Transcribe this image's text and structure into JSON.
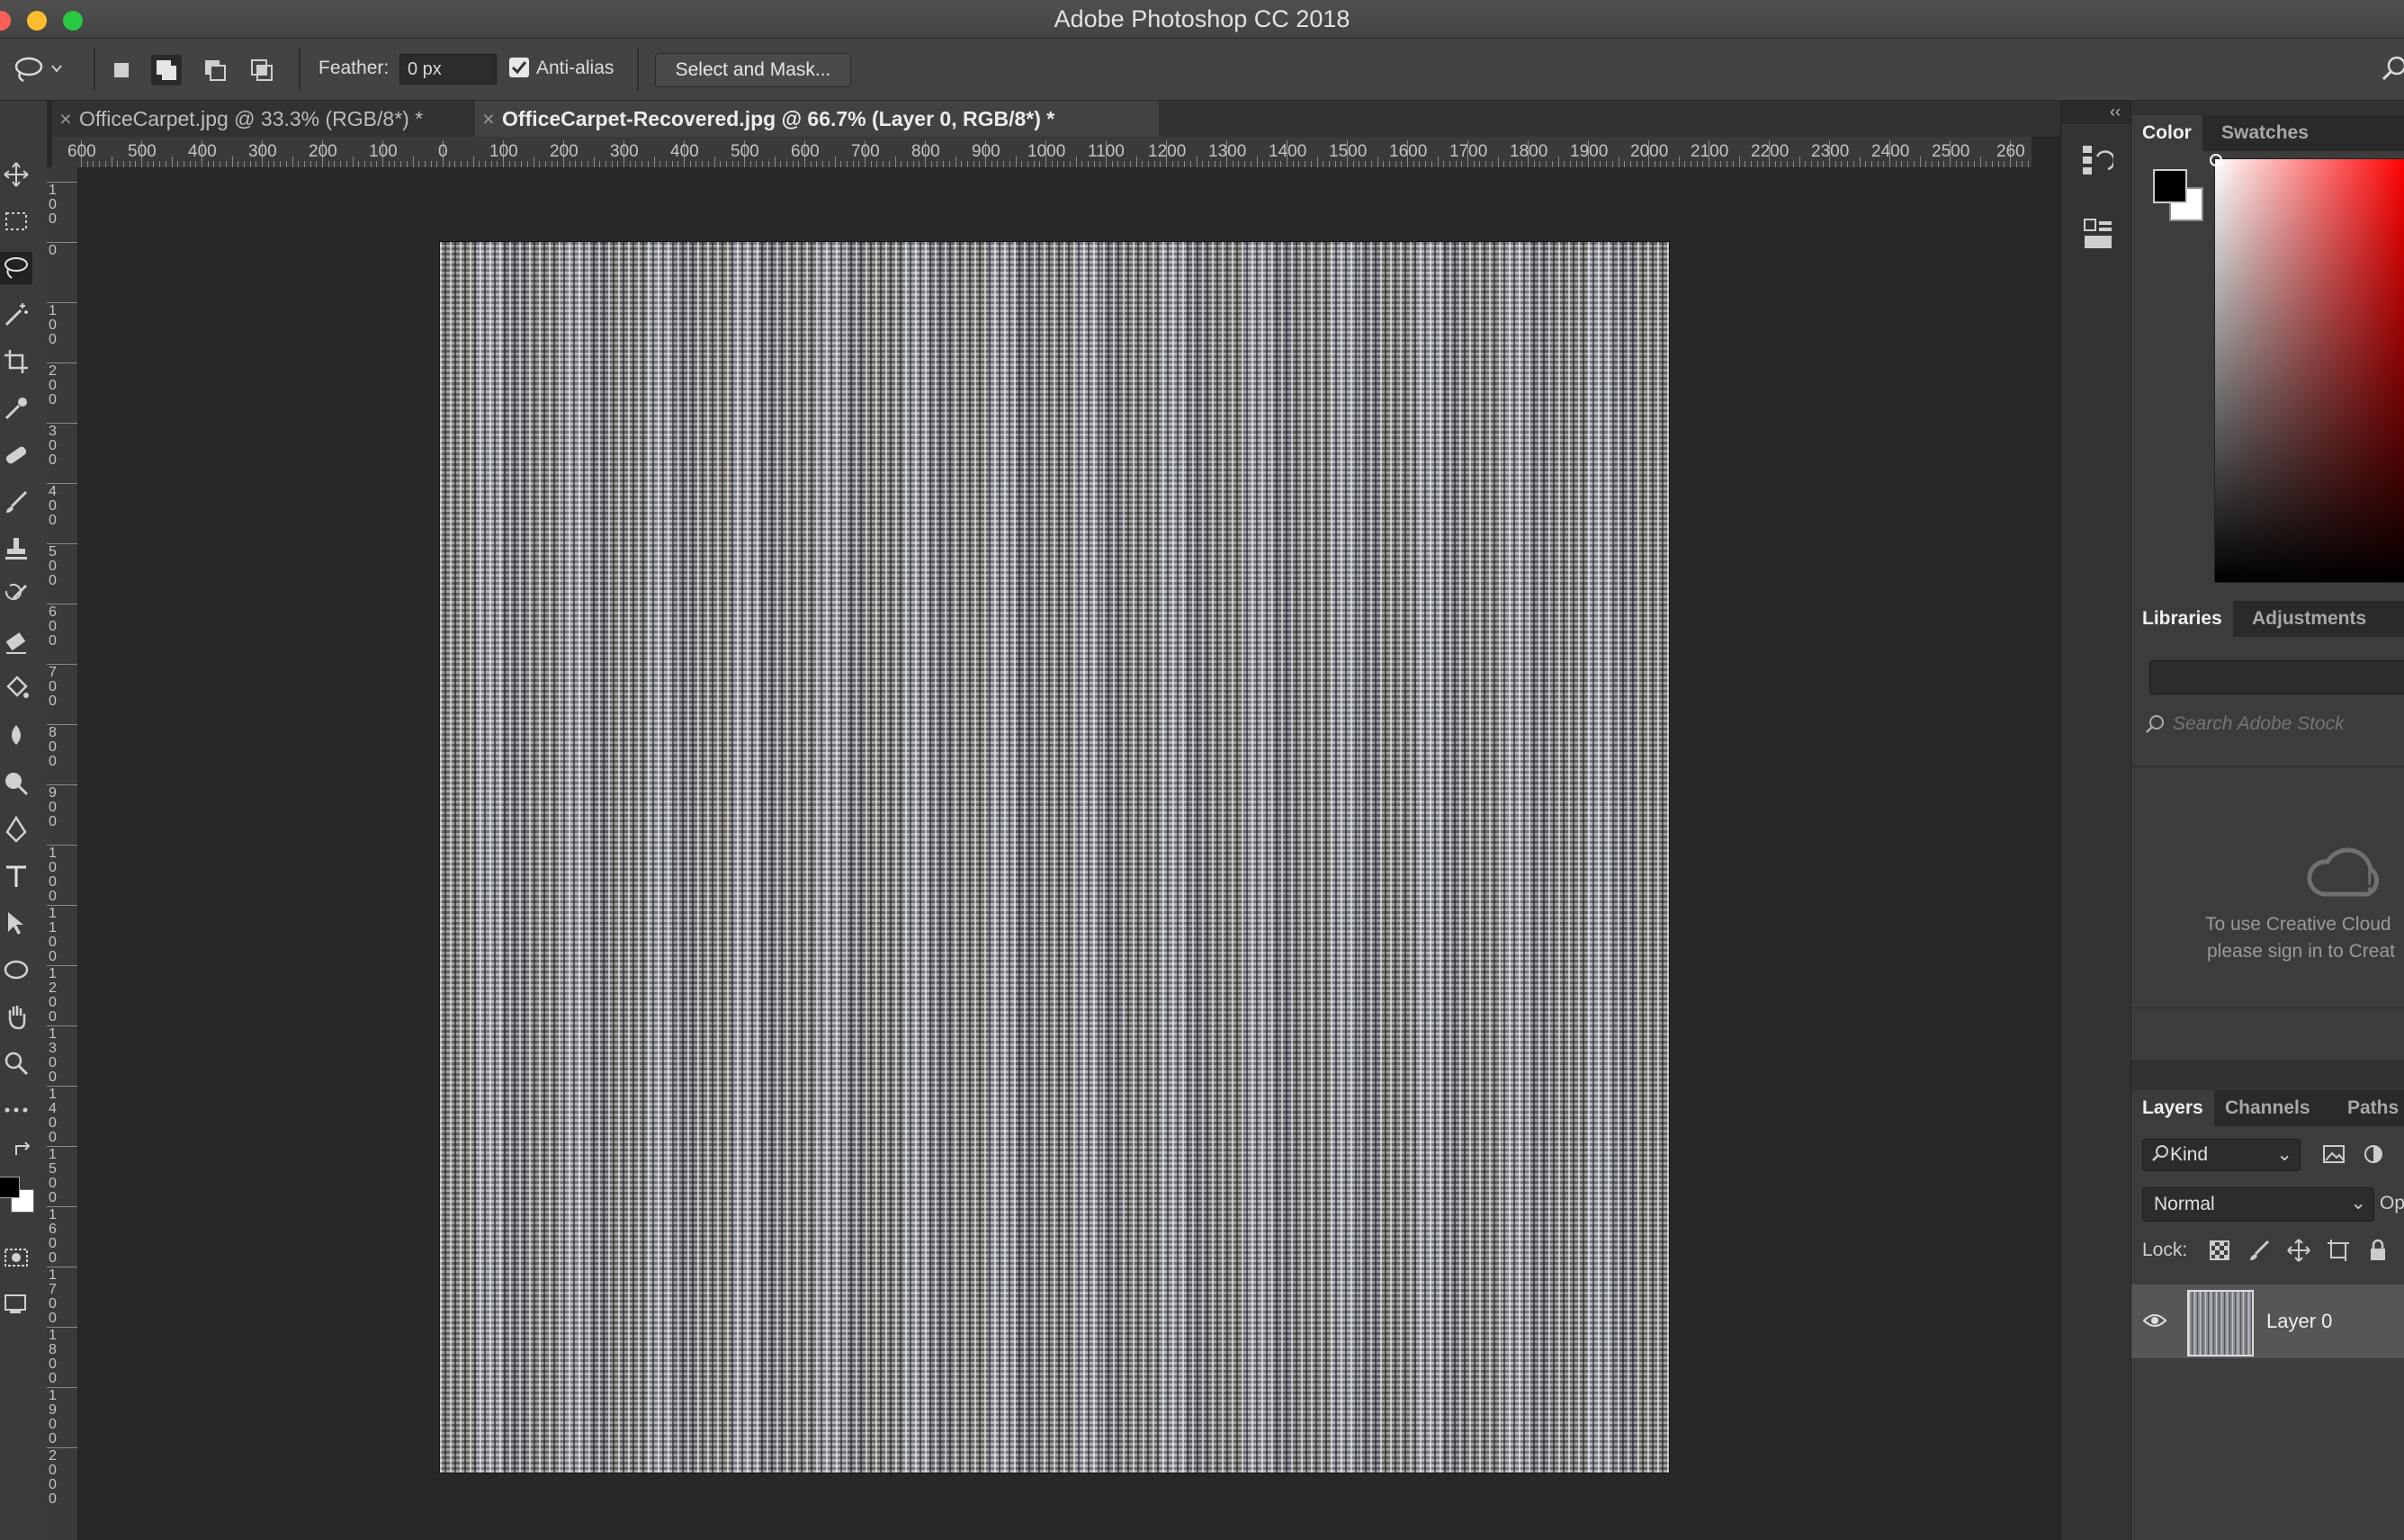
{
  "window": {
    "title": "Adobe Photoshop CC 2018"
  },
  "options_bar": {
    "feather_label": "Feather:",
    "feather_value": "0 px",
    "antialias_label": "Anti-alias",
    "antialias_checked": true,
    "select_mask_label": "Select and Mask..."
  },
  "tabs": [
    {
      "close": "×",
      "label": "OfficeCarpet.jpg @ 33.3% (RGB/8*) *",
      "active": false
    },
    {
      "close": "×",
      "label": "OfficeCarpet-Recovered.jpg @ 66.7% (Layer 0, RGB/8*) *",
      "active": true
    }
  ],
  "ruler_h": [
    "600",
    "500",
    "400",
    "300",
    "200",
    "100",
    "0",
    "100",
    "200",
    "300",
    "400",
    "500",
    "600",
    "700",
    "800",
    "900",
    "1000",
    "1100",
    "1200",
    "1300",
    "1400",
    "1500",
    "1600",
    "1700",
    "1800",
    "1900",
    "2000",
    "2100",
    "2200",
    "2300",
    "2400",
    "2500",
    "260"
  ],
  "ruler_v": [
    "100",
    "0",
    "100",
    "200",
    "300",
    "400",
    "500",
    "600",
    "700",
    "800",
    "900",
    "1000",
    "1100",
    "1200",
    "1300",
    "1400",
    "1500",
    "1600",
    "1700",
    "1800",
    "1900",
    "2000"
  ],
  "color_panel": {
    "tab_color": "Color",
    "tab_swatches": "Swatches",
    "fg": "#000000",
    "bg": "#ffffff"
  },
  "libraries_panel": {
    "tab_libraries": "Libraries",
    "tab_adjustments": "Adjustments",
    "search_placeholder": "Search Adobe Stock",
    "message_line1": "To use Creative Cloud",
    "message_line2": "please sign in to Creat"
  },
  "layers_panel": {
    "tab_layers": "Layers",
    "tab_channels": "Channels",
    "tab_paths": "Paths",
    "filter_kind": "Kind",
    "blend_mode": "Normal",
    "opacity_label": "Op",
    "lock_label": "Lock:",
    "layers": [
      {
        "name": "Layer 0",
        "visible": true
      }
    ]
  },
  "colors": {
    "accent": "#3c3c3c",
    "close_red": "#fe5f57",
    "min_yellow": "#febc2e",
    "max_green": "#28c840"
  }
}
